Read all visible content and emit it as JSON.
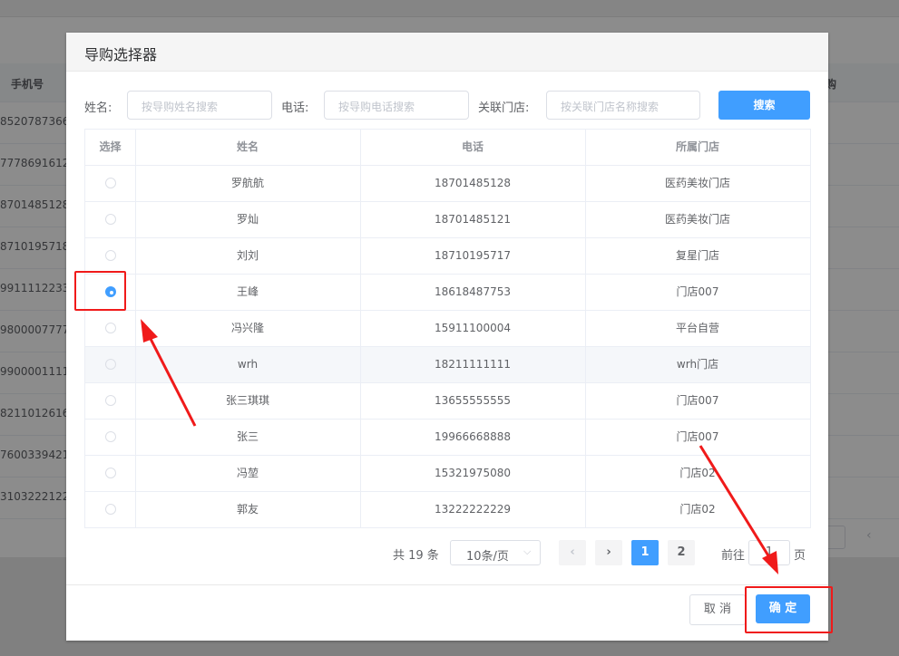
{
  "background": {
    "column_phone": "手机号",
    "column_right": "购",
    "rows": [
      "8520787366",
      "7778691612",
      "8701485128",
      "8710195718",
      "9911112233",
      "9800007777",
      "9900001111",
      "8211012616",
      "7600339421",
      "3103222122"
    ]
  },
  "dialog": {
    "title": "导购选择器",
    "search": {
      "name_label": "姓名:",
      "name_placeholder": "按导购姓名搜索",
      "phone_label": "电话:",
      "phone_placeholder": "按导购电话搜索",
      "store_label": "关联门店:",
      "store_placeholder": "按关联门店名称搜索",
      "search_button": "搜索"
    },
    "table": {
      "headers": [
        "选择",
        "姓名",
        "电话",
        "所属门店"
      ],
      "rows": [
        {
          "name": "罗航航",
          "phone": "18701485128",
          "store": "医药美妆门店",
          "selected": false
        },
        {
          "name": "罗灿",
          "phone": "18701485121",
          "store": "医药美妆门店",
          "selected": false
        },
        {
          "name": "刘刘",
          "phone": "18710195717",
          "store": "复星门店",
          "selected": false
        },
        {
          "name": "王峰",
          "phone": "18618487753",
          "store": "门店007",
          "selected": true
        },
        {
          "name": "冯兴隆",
          "phone": "15911100004",
          "store": "平台自营",
          "selected": false
        },
        {
          "name": "wrh",
          "phone": "18211111111",
          "store": "wrh门店",
          "selected": false
        },
        {
          "name": "张三琪琪",
          "phone": "13655555555",
          "store": "门店007",
          "selected": false
        },
        {
          "name": "张三",
          "phone": "19966668888",
          "store": "门店007",
          "selected": false
        },
        {
          "name": "冯堃",
          "phone": "15321975080",
          "store": "门店02",
          "selected": false
        },
        {
          "name": "郭友",
          "phone": "13222222229",
          "store": "门店02",
          "selected": false
        }
      ]
    },
    "pagination": {
      "total": "共 19 条",
      "page_size": "10条/页",
      "prev": "‹",
      "next": "›",
      "pages": [
        "1",
        "2"
      ],
      "current_page": "1",
      "goto_label": "前往",
      "goto_value": "1",
      "page_suffix": "页"
    },
    "footer": {
      "cancel": "取 消",
      "confirm": "确 定"
    }
  },
  "colors": {
    "primary": "#409eff",
    "annotation": "#f01a1a"
  }
}
